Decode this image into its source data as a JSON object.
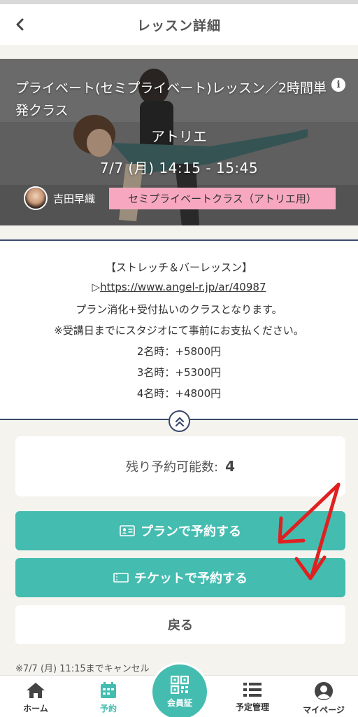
{
  "header": {
    "title": "レッスン詳細",
    "back_icon": "chevron-left-icon"
  },
  "lesson": {
    "class_name": "プライベート(セミプライベート)レッスン／2時間単発クラス",
    "studio": "アトリエ",
    "datetime": "7/7 (月) 14:15 - 15:45",
    "instructor": "吉田早織",
    "class_type": "セミプライベートクラス（アトリエ用）"
  },
  "description": {
    "lines": [
      "【ストレッチ＆バーレッスン】",
      "▷",
      "プラン消化+受付払いのクラスとなります。",
      "※受講日までにスタジオにて事前にお支払ください。",
      "2名時：+5800円",
      "3名時：+5300円",
      "4名時：+4800円"
    ],
    "link": "https://www.angel-r.jp/ar/40987"
  },
  "remaining": {
    "label": "残り予約可能数:",
    "value": "4"
  },
  "buttons": {
    "plan": "プランで予約する",
    "ticket": "チケットで予約する",
    "back": "戻る"
  },
  "cancel_note": "※7/7 (月) 11:15までキャンセル",
  "tabbar": {
    "home": "ホーム",
    "reserve": "予約",
    "member": "会員証",
    "schedule": "予定管理",
    "mypage": "マイページ"
  },
  "colors": {
    "accent": "#45bcb0",
    "badge": "#f7a8c0",
    "divider": "#3b4a6b",
    "annotation": "#e02020"
  }
}
